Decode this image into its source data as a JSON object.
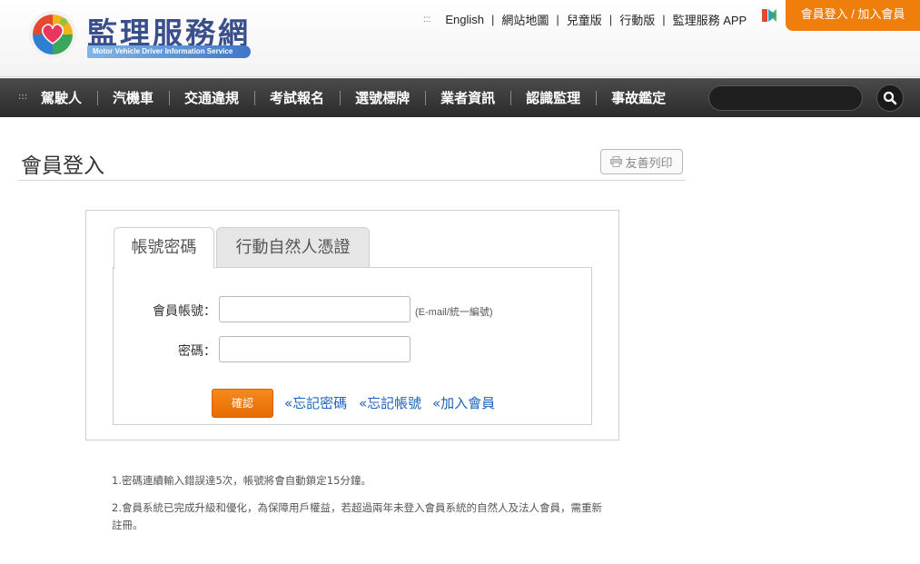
{
  "header": {
    "logo_title": "監理服務網",
    "logo_subtitle": "Motor Vehicle Driver Information Service",
    "accesskey_top": ":::",
    "links": [
      "English",
      "網站地圖",
      "兒童版",
      "行動版",
      "監理服務 APP"
    ],
    "separator": "|",
    "member_button": "會員登入 / 加入會員"
  },
  "nav": {
    "accesskey": ":::",
    "items": [
      "駕駛人",
      "汽機車",
      "交通違規",
      "考試報名",
      "選號標牌",
      "業者資訊",
      "認識監理",
      "事故鑑定"
    ],
    "search_value": ""
  },
  "page": {
    "title": "會員登入",
    "print_label": "友善列印"
  },
  "login": {
    "tabs": [
      "帳號密碼",
      "行動自然人憑證"
    ],
    "account_label": "會員帳號：",
    "account_value": "",
    "account_hint": "(E-mail/統一編號)",
    "password_label": "密碼：",
    "password_value": "",
    "confirm_label": "確認",
    "links": [
      "«忘記密碼",
      "«忘記帳號",
      "«加入會員"
    ]
  },
  "notes": [
    "1.密碼連續輸入錯誤達5次，帳號將會自動鎖定15分鐘。",
    "2.會員系統已完成升級和優化，為保障用戶權益，若超過兩年未登入會員系統的自然人及法人會員，需重新註冊。"
  ],
  "colors": {
    "accent_orange": "#f07e0a",
    "nav_bg": "#2b2b2b",
    "link_blue": "#1f63b8",
    "logo_blue": "#3a4e8c"
  }
}
